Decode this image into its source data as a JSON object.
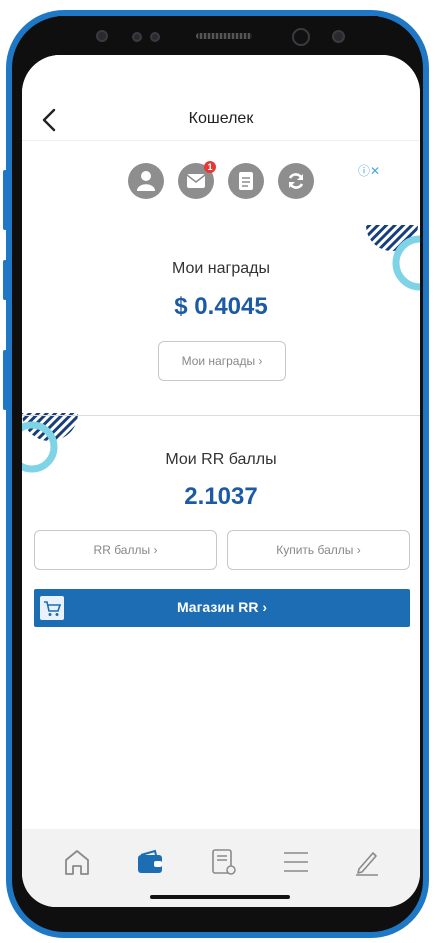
{
  "header": {
    "title": "Кошелек"
  },
  "ad": {
    "label": "ⓘ✕"
  },
  "notification_badge": "1",
  "rewards": {
    "title": "Мои награды",
    "value": "$ 0.4045",
    "button_label": "Мои награды ›"
  },
  "rr_points": {
    "title": "Мои RR баллы",
    "value": "2.1037",
    "points_button_label": "RR баллы ›",
    "buy_button_label": "Купить баллы ›"
  },
  "shop": {
    "label": "Магазин RR  ›"
  },
  "tabs": [
    {
      "icon": "home-icon"
    },
    {
      "icon": "wallet-icon",
      "active": true
    },
    {
      "icon": "document-icon"
    },
    {
      "icon": "menu-icon"
    },
    {
      "icon": "pencil-icon"
    }
  ],
  "colors": {
    "accent": "#1c5aa6",
    "shop_bar": "#1c6db4",
    "phone_frame": "#1f78c6",
    "decor_ring": "#7fd3e6"
  }
}
